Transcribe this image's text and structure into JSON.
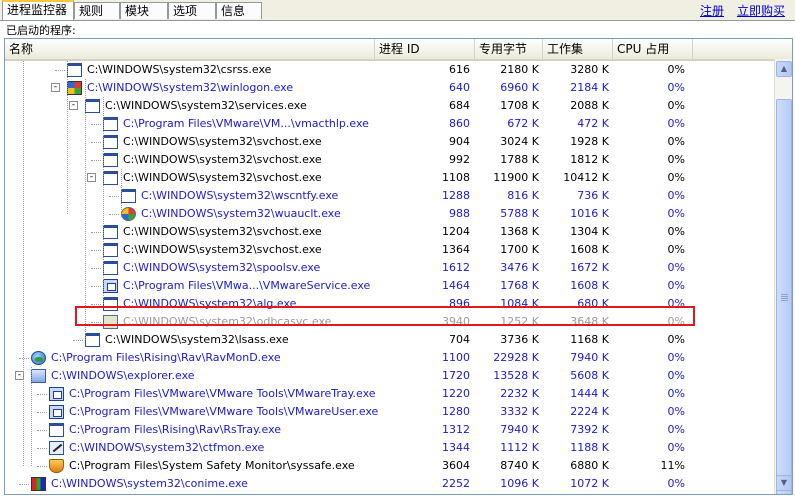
{
  "tabs": [
    "进程监控器",
    "规则",
    "模块",
    "选项",
    "信息"
  ],
  "links": {
    "register": "注册",
    "buy": "立即购买"
  },
  "caption": "已启动的程序:",
  "columns": [
    "名称",
    "进程 ID",
    "专用字节",
    "工作集",
    "CPU 占用"
  ],
  "colors": {
    "blue": "#1a1acc",
    "gray": "#9a9a9a",
    "highlight": "#e0191e"
  },
  "rows": [
    {
      "name": "C:\\WINDOWS\\system32\\csrss.exe",
      "pid": "616",
      "priv": "2180 K",
      "ws": "3280 K",
      "cpu": "0%",
      "color": "black",
      "icon": "window-icon",
      "level": 3,
      "expander": ""
    },
    {
      "name": "C:\\WINDOWS\\system32\\winlogon.exe",
      "pid": "640",
      "priv": "6960 K",
      "ws": "2184 K",
      "cpu": "0%",
      "color": "blue",
      "icon": "winlogon-icon",
      "level": 3,
      "expander": "-"
    },
    {
      "name": "C:\\WINDOWS\\system32\\services.exe",
      "pid": "684",
      "priv": "1708 K",
      "ws": "2088 K",
      "cpu": "0%",
      "color": "black",
      "icon": "window-icon",
      "level": 4,
      "expander": "-"
    },
    {
      "name": "C:\\Program Files\\VMware\\VM...\\vmacthlp.exe",
      "pid": "860",
      "priv": "672 K",
      "ws": "472 K",
      "cpu": "0%",
      "color": "blue",
      "icon": "window-icon",
      "level": 5,
      "expander": ""
    },
    {
      "name": "C:\\WINDOWS\\system32\\svchost.exe",
      "pid": "904",
      "priv": "3024 K",
      "ws": "1928 K",
      "cpu": "0%",
      "color": "black",
      "icon": "window-icon",
      "level": 5,
      "expander": ""
    },
    {
      "name": "C:\\WINDOWS\\system32\\svchost.exe",
      "pid": "992",
      "priv": "1788 K",
      "ws": "1812 K",
      "cpu": "0%",
      "color": "black",
      "icon": "window-icon",
      "level": 5,
      "expander": ""
    },
    {
      "name": "C:\\WINDOWS\\system32\\svchost.exe",
      "pid": "1108",
      "priv": "11900 K",
      "ws": "10412 K",
      "cpu": "0%",
      "color": "black",
      "icon": "window-icon",
      "level": 5,
      "expander": "-"
    },
    {
      "name": "C:\\WINDOWS\\system32\\wscntfy.exe",
      "pid": "1288",
      "priv": "816 K",
      "ws": "736 K",
      "cpu": "0%",
      "color": "blue",
      "icon": "window-icon",
      "level": 6,
      "expander": ""
    },
    {
      "name": "C:\\WINDOWS\\system32\\wuauclt.exe",
      "pid": "988",
      "priv": "5788 K",
      "ws": "1016 K",
      "cpu": "0%",
      "color": "blue",
      "icon": "windows-update-icon",
      "level": 6,
      "expander": ""
    },
    {
      "name": "C:\\WINDOWS\\system32\\svchost.exe",
      "pid": "1204",
      "priv": "1368 K",
      "ws": "1304 K",
      "cpu": "0%",
      "color": "black",
      "icon": "window-icon",
      "level": 5,
      "expander": ""
    },
    {
      "name": "C:\\WINDOWS\\system32\\svchost.exe",
      "pid": "1364",
      "priv": "1700 K",
      "ws": "1608 K",
      "cpu": "0%",
      "color": "black",
      "icon": "window-icon",
      "level": 5,
      "expander": ""
    },
    {
      "name": "C:\\WINDOWS\\system32\\spoolsv.exe",
      "pid": "1612",
      "priv": "3476 K",
      "ws": "1672 K",
      "cpu": "0%",
      "color": "blue",
      "icon": "window-icon",
      "level": 5,
      "expander": ""
    },
    {
      "name": "C:\\Program Files\\VMwa...\\VMwareService.exe",
      "pid": "1464",
      "priv": "1768 K",
      "ws": "1608 K",
      "cpu": "0%",
      "color": "blue",
      "icon": "vmware-icon",
      "level": 5,
      "expander": ""
    },
    {
      "name": "C:\\WINDOWS\\system32\\alg.exe",
      "pid": "896",
      "priv": "1084 K",
      "ws": "680 K",
      "cpu": "0%",
      "color": "blue",
      "icon": "window-icon",
      "level": 5,
      "expander": ""
    },
    {
      "name": "C:\\WINDOWS\\system32\\odbcasvc.exe",
      "pid": "3940",
      "priv": "1252 K",
      "ws": "3648 K",
      "cpu": "0%",
      "color": "gray",
      "icon": "gear-icon",
      "level": 5,
      "expander": ""
    },
    {
      "name": "C:\\WINDOWS\\system32\\lsass.exe",
      "pid": "704",
      "priv": "3736 K",
      "ws": "1168 K",
      "cpu": "0%",
      "color": "black",
      "icon": "window-icon",
      "level": 4,
      "expander": ""
    },
    {
      "name": "C:\\Program Files\\Rising\\Rav\\RavMonD.exe",
      "pid": "1100",
      "priv": "22928 K",
      "ws": "7940 K",
      "cpu": "0%",
      "color": "blue",
      "icon": "globe-icon",
      "level": 1,
      "expander": ""
    },
    {
      "name": "C:\\WINDOWS\\explorer.exe",
      "pid": "1720",
      "priv": "13528 K",
      "ws": "5608 K",
      "cpu": "0%",
      "color": "blue",
      "icon": "computer-icon",
      "level": 1,
      "expander": "-"
    },
    {
      "name": "C:\\Program Files\\VMware\\VMware Tools\\VMwareTray.exe",
      "pid": "1220",
      "priv": "2232 K",
      "ws": "1444 K",
      "cpu": "0%",
      "color": "blue",
      "icon": "vmware-icon",
      "level": 2,
      "expander": ""
    },
    {
      "name": "C:\\Program Files\\VMware\\VMware Tools\\VMwareUser.exe",
      "pid": "1280",
      "priv": "3332 K",
      "ws": "2224 K",
      "cpu": "0%",
      "color": "blue",
      "icon": "vmware-icon",
      "level": 2,
      "expander": ""
    },
    {
      "name": "C:\\Program Files\\Rising\\Rav\\RsTray.exe",
      "pid": "1312",
      "priv": "7940 K",
      "ws": "7392 K",
      "cpu": "0%",
      "color": "blue",
      "icon": "window-icon",
      "level": 2,
      "expander": ""
    },
    {
      "name": "C:\\WINDOWS\\system32\\ctfmon.exe",
      "pid": "1344",
      "priv": "1112 K",
      "ws": "1188 K",
      "cpu": "0%",
      "color": "blue",
      "icon": "pen-icon",
      "level": 2,
      "expander": ""
    },
    {
      "name": "C:\\Program Files\\System Safety Monitor\\syssafe.exe",
      "pid": "3604",
      "priv": "8740 K",
      "ws": "6880 K",
      "cpu": "11%",
      "color": "black",
      "icon": "shield-icon",
      "level": 2,
      "expander": ""
    },
    {
      "name": "C:\\WINDOWS\\system32\\conime.exe",
      "pid": "2252",
      "priv": "1096 K",
      "ws": "1072 K",
      "cpu": "0%",
      "color": "blue",
      "icon": "conime-icon",
      "level": 1,
      "expander": ""
    }
  ]
}
